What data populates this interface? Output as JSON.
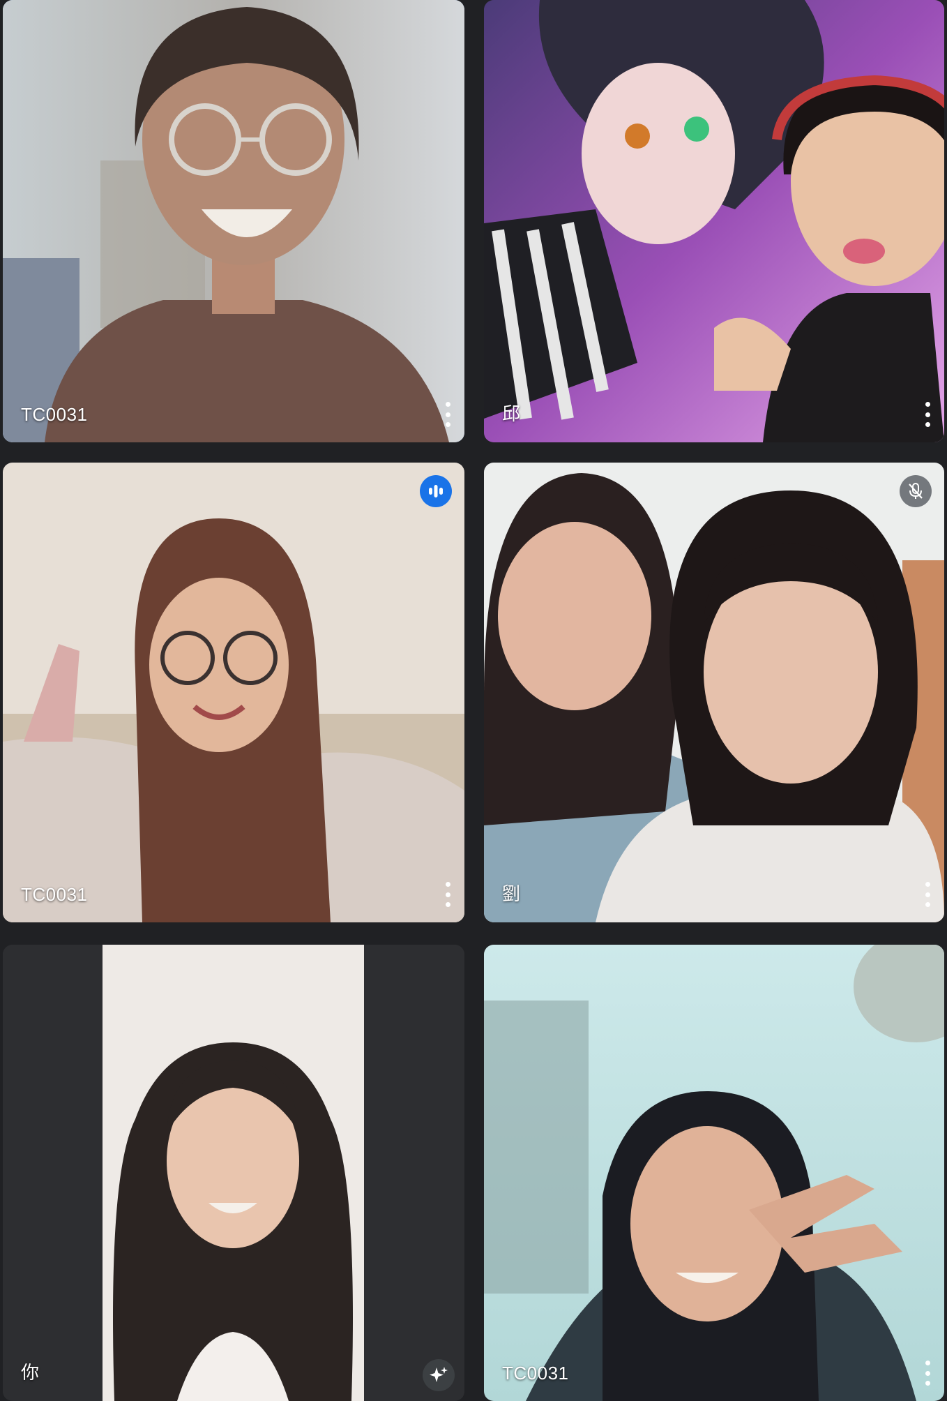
{
  "participants": [
    {
      "name": "TC0031",
      "speaking": false,
      "muted": false,
      "active": true
    },
    {
      "name": "邱",
      "speaking": false,
      "muted": false,
      "active": false
    },
    {
      "name": "TC0031",
      "speaking": true,
      "muted": false,
      "active": false
    },
    {
      "name": "劉",
      "speaking": false,
      "muted": true,
      "active": false
    },
    {
      "name": "你",
      "speaking": false,
      "muted": false,
      "active": false,
      "self": true
    },
    {
      "name": "TC0031",
      "speaking": false,
      "muted": false,
      "active": false
    }
  ],
  "colors": {
    "background": "#202124",
    "active_border": "#8ab4f8",
    "speaking_badge": "#1a73e8",
    "muted_badge": "#5f6368"
  },
  "icons": {
    "speaking": "audio-level-icon",
    "muted": "mic-off-icon",
    "more": "more-vert-icon",
    "effects": "sparkle-effects-icon"
  }
}
